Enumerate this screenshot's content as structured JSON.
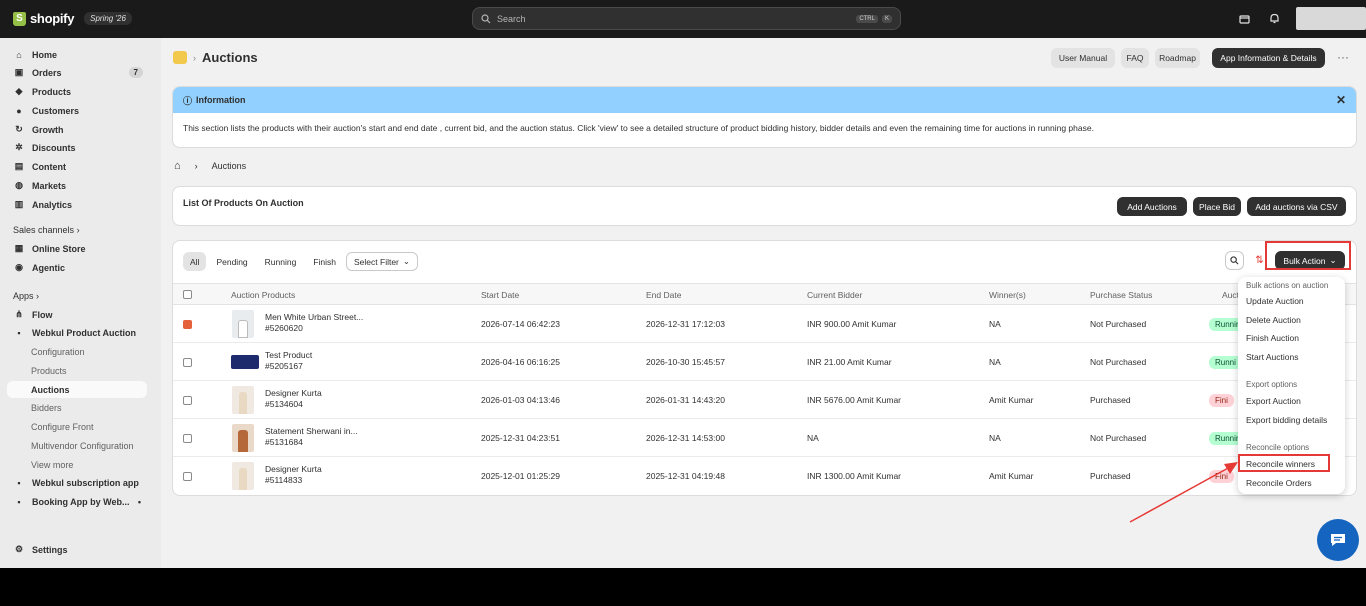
{
  "topbar": {
    "brand": "shopify",
    "edition": "Spring '26",
    "search_placeholder": "Search",
    "kbd1": "CTRL",
    "kbd2": "K"
  },
  "sidebar": {
    "home": "Home",
    "orders": "Orders",
    "orders_count": "7",
    "products": "Products",
    "customers": "Customers",
    "growth": "Growth",
    "discounts": "Discounts",
    "content": "Content",
    "markets": "Markets",
    "analytics": "Analytics",
    "sales_channels": "Sales channels",
    "online_store": "Online Store",
    "agentic": "Agentic",
    "apps": "Apps",
    "flow": "Flow",
    "webkul_auction": "Webkul Product Auction",
    "configuration": "Configuration",
    "products_sub": "Products",
    "auctions": "Auctions",
    "bidders": "Bidders",
    "configure_front": "Configure Front",
    "multivendor": "Multivendor Configuration",
    "view_more": "View more",
    "subscription": "Webkul subscription app",
    "booking": "Booking App by Web...",
    "settings": "Settings"
  },
  "header": {
    "title": "Auctions",
    "user_manual": "User Manual",
    "faq": "FAQ",
    "roadmap": "Roadmap",
    "app_info": "App Information & Details"
  },
  "info": {
    "title": "Information",
    "body": "This section lists the products with their auction's start and end date , current bid, and the auction status. Click 'view' to see a detailed structure of product bidding history, bidder details and even the remaining time for auctions in running phase."
  },
  "breadcrumb": {
    "current": "Auctions"
  },
  "list": {
    "title": "List Of Products On Auction",
    "add_auctions": "Add Auctions",
    "place_bid": "Place Bid",
    "add_csv": "Add auctions via CSV"
  },
  "filters": {
    "all": "All",
    "pending": "Pending",
    "running": "Running",
    "finish": "Finish",
    "select_filter": "Select Filter",
    "bulk_action": "Bulk Action"
  },
  "table": {
    "headers": [
      "Auction Products",
      "Start Date",
      "End Date",
      "Current Bidder",
      "Winner(s)",
      "Purchase Status",
      "Auct"
    ],
    "rows": [
      {
        "name": "Men White Urban Street...",
        "id": "#5260620",
        "start": "2026-07-14 06:42:23",
        "end": "2026-12-31 17:12:03",
        "bidder": "INR 900.00 Amit Kumar",
        "winner": "NA",
        "purchase": "Not Purchased",
        "status": "Running"
      },
      {
        "name": "Test Product",
        "id": "#5205167",
        "start": "2026-04-16 06:16:25",
        "end": "2026-10-30 15:45:57",
        "bidder": "INR 21.00 Amit Kumar",
        "winner": "NA",
        "purchase": "Not Purchased",
        "status": "Runni"
      },
      {
        "name": "Designer Kurta",
        "id": "#5134604",
        "start": "2026-01-03 04:13:46",
        "end": "2026-01-31 14:43:20",
        "bidder": "INR 5676.00 Amit Kumar",
        "winner": "Amit Kumar",
        "purchase": "Purchased",
        "status": "Fini"
      },
      {
        "name": "Statement Sherwani in...",
        "id": "#5131684",
        "start": "2025-12-31 04:23:51",
        "end": "2026-12-31 14:53:00",
        "bidder": "NA",
        "winner": "NA",
        "purchase": "Not Purchased",
        "status": "Running"
      },
      {
        "name": "Designer Kurta",
        "id": "#5114833",
        "start": "2025-12-01 01:25:29",
        "end": "2025-12-31 04:19:48",
        "bidder": "INR 1300.00 Amit Kumar",
        "winner": "Amit Kumar",
        "purchase": "Purchased",
        "status": "Fini"
      }
    ]
  },
  "dropdown": {
    "section1": "Bulk actions on auction",
    "update": "Update Auction",
    "delete": "Delete Auction",
    "finish": "Finish Auction",
    "start": "Start Auctions",
    "section2": "Export options",
    "export": "Export Auction",
    "export_bidding": "Export bidding details",
    "section3": "Reconcile options",
    "reconcile_winners": "Reconcile winners",
    "reconcile_orders": "Reconcile Orders"
  }
}
